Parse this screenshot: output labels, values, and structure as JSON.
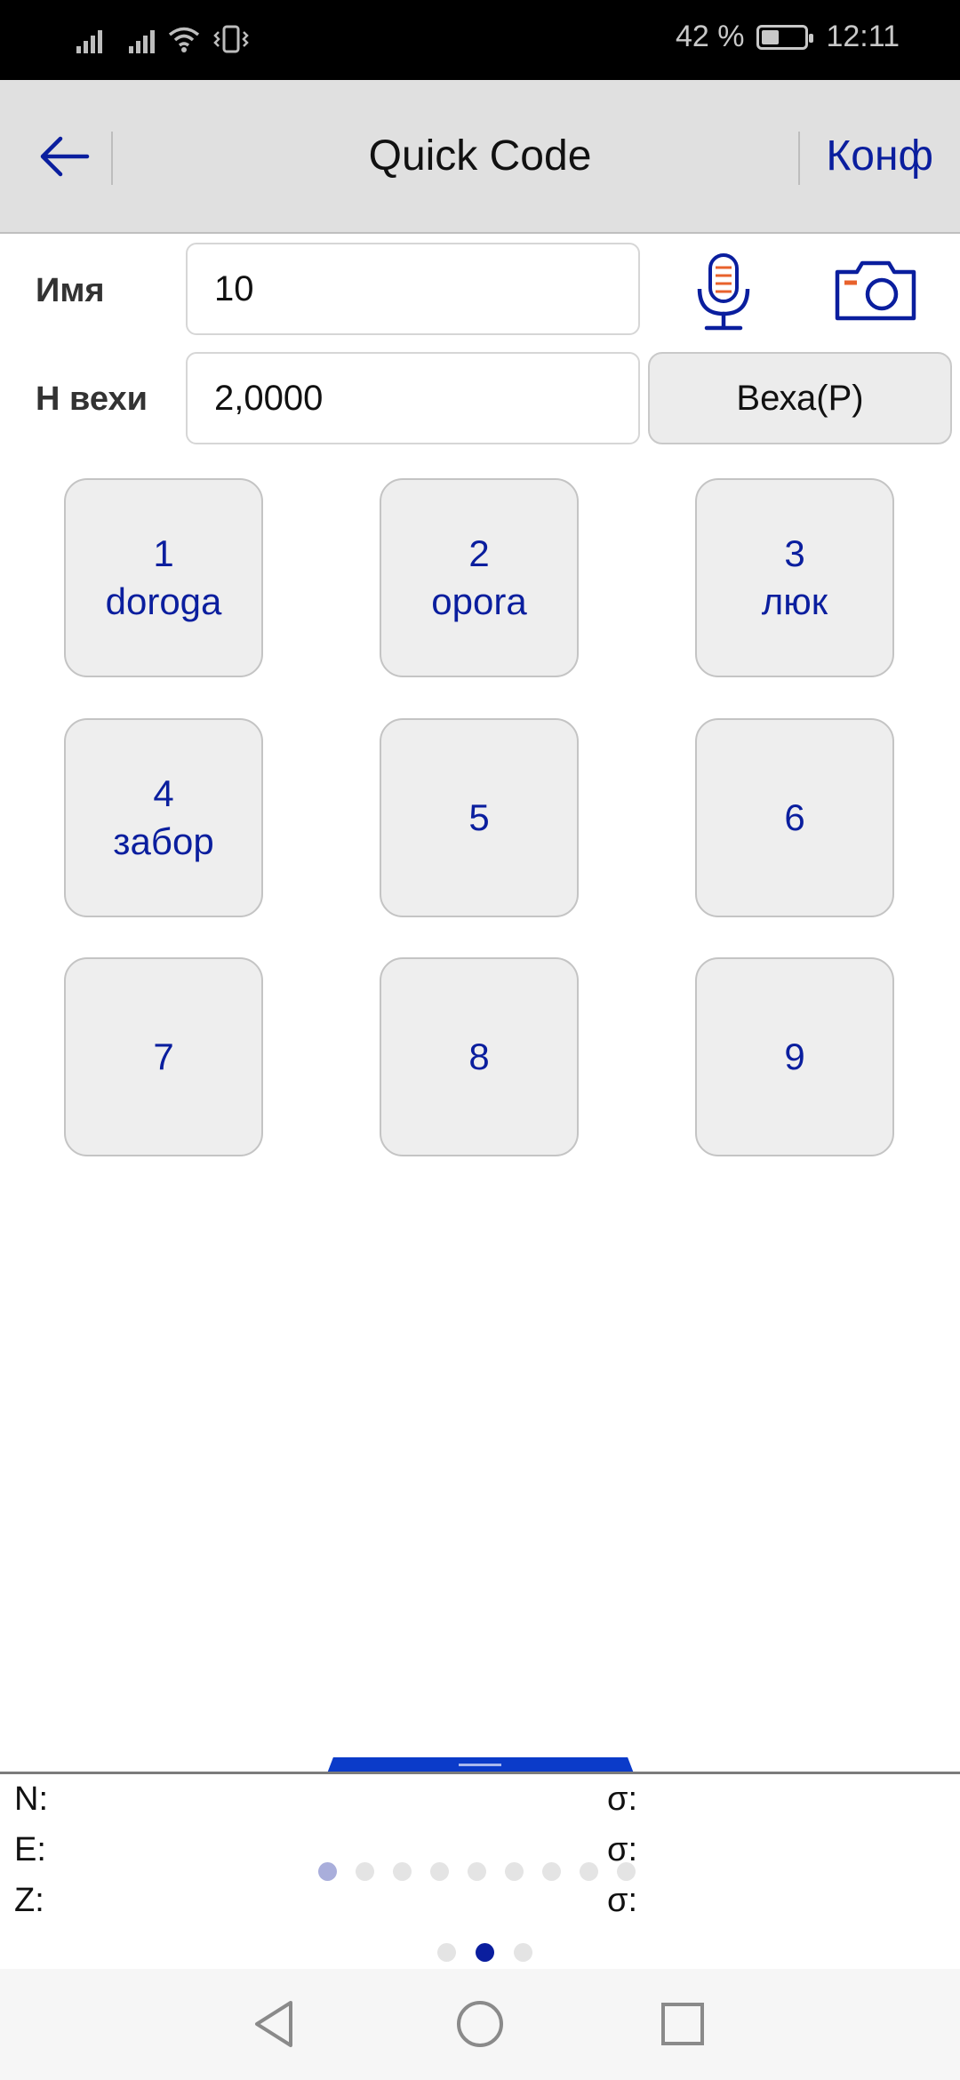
{
  "status_bar": {
    "battery_text": "42 %",
    "time": "12:11",
    "battery_level": 0.42,
    "icons": [
      "signal-icon",
      "signal-icon",
      "wifi-icon",
      "vibrate-icon",
      "battery-icon"
    ]
  },
  "app_bar": {
    "title": "Quick Code",
    "conf_label": "Конф",
    "back_icon": "arrow-left-icon"
  },
  "form": {
    "name_label": "Имя",
    "name_value": "10",
    "pole_label": "H вехи",
    "pole_value": "2,0000",
    "pole_button": "Веха(P)",
    "mic_icon": "microphone-icon",
    "camera_icon": "camera-icon"
  },
  "codes": [
    {
      "number": "1",
      "name": "doroga"
    },
    {
      "number": "2",
      "name": "opora"
    },
    {
      "number": "3",
      "name": "люк"
    },
    {
      "number": "4",
      "name": "забор"
    },
    {
      "number": "5",
      "name": ""
    },
    {
      "number": "6",
      "name": ""
    },
    {
      "number": "7",
      "name": ""
    },
    {
      "number": "8",
      "name": ""
    },
    {
      "number": "9",
      "name": ""
    }
  ],
  "coords": {
    "n_label": "N:",
    "e_label": "E:",
    "z_label": "Z:",
    "sigma_label": "σ:"
  },
  "pager": {
    "inner_active": 1,
    "inner_count": 9,
    "outer_active": 2,
    "outer_count": 3
  },
  "colors": {
    "accent": "#0a1e9e",
    "panel_tab": "#0b3bc9",
    "app_bar_bg": "#e0e0e0",
    "button_bg": "#eeeeee",
    "mic_accent": "#e8622c"
  },
  "nav_bar": {
    "icons": [
      "back-triangle-icon",
      "home-circle-icon",
      "recents-square-icon"
    ]
  }
}
